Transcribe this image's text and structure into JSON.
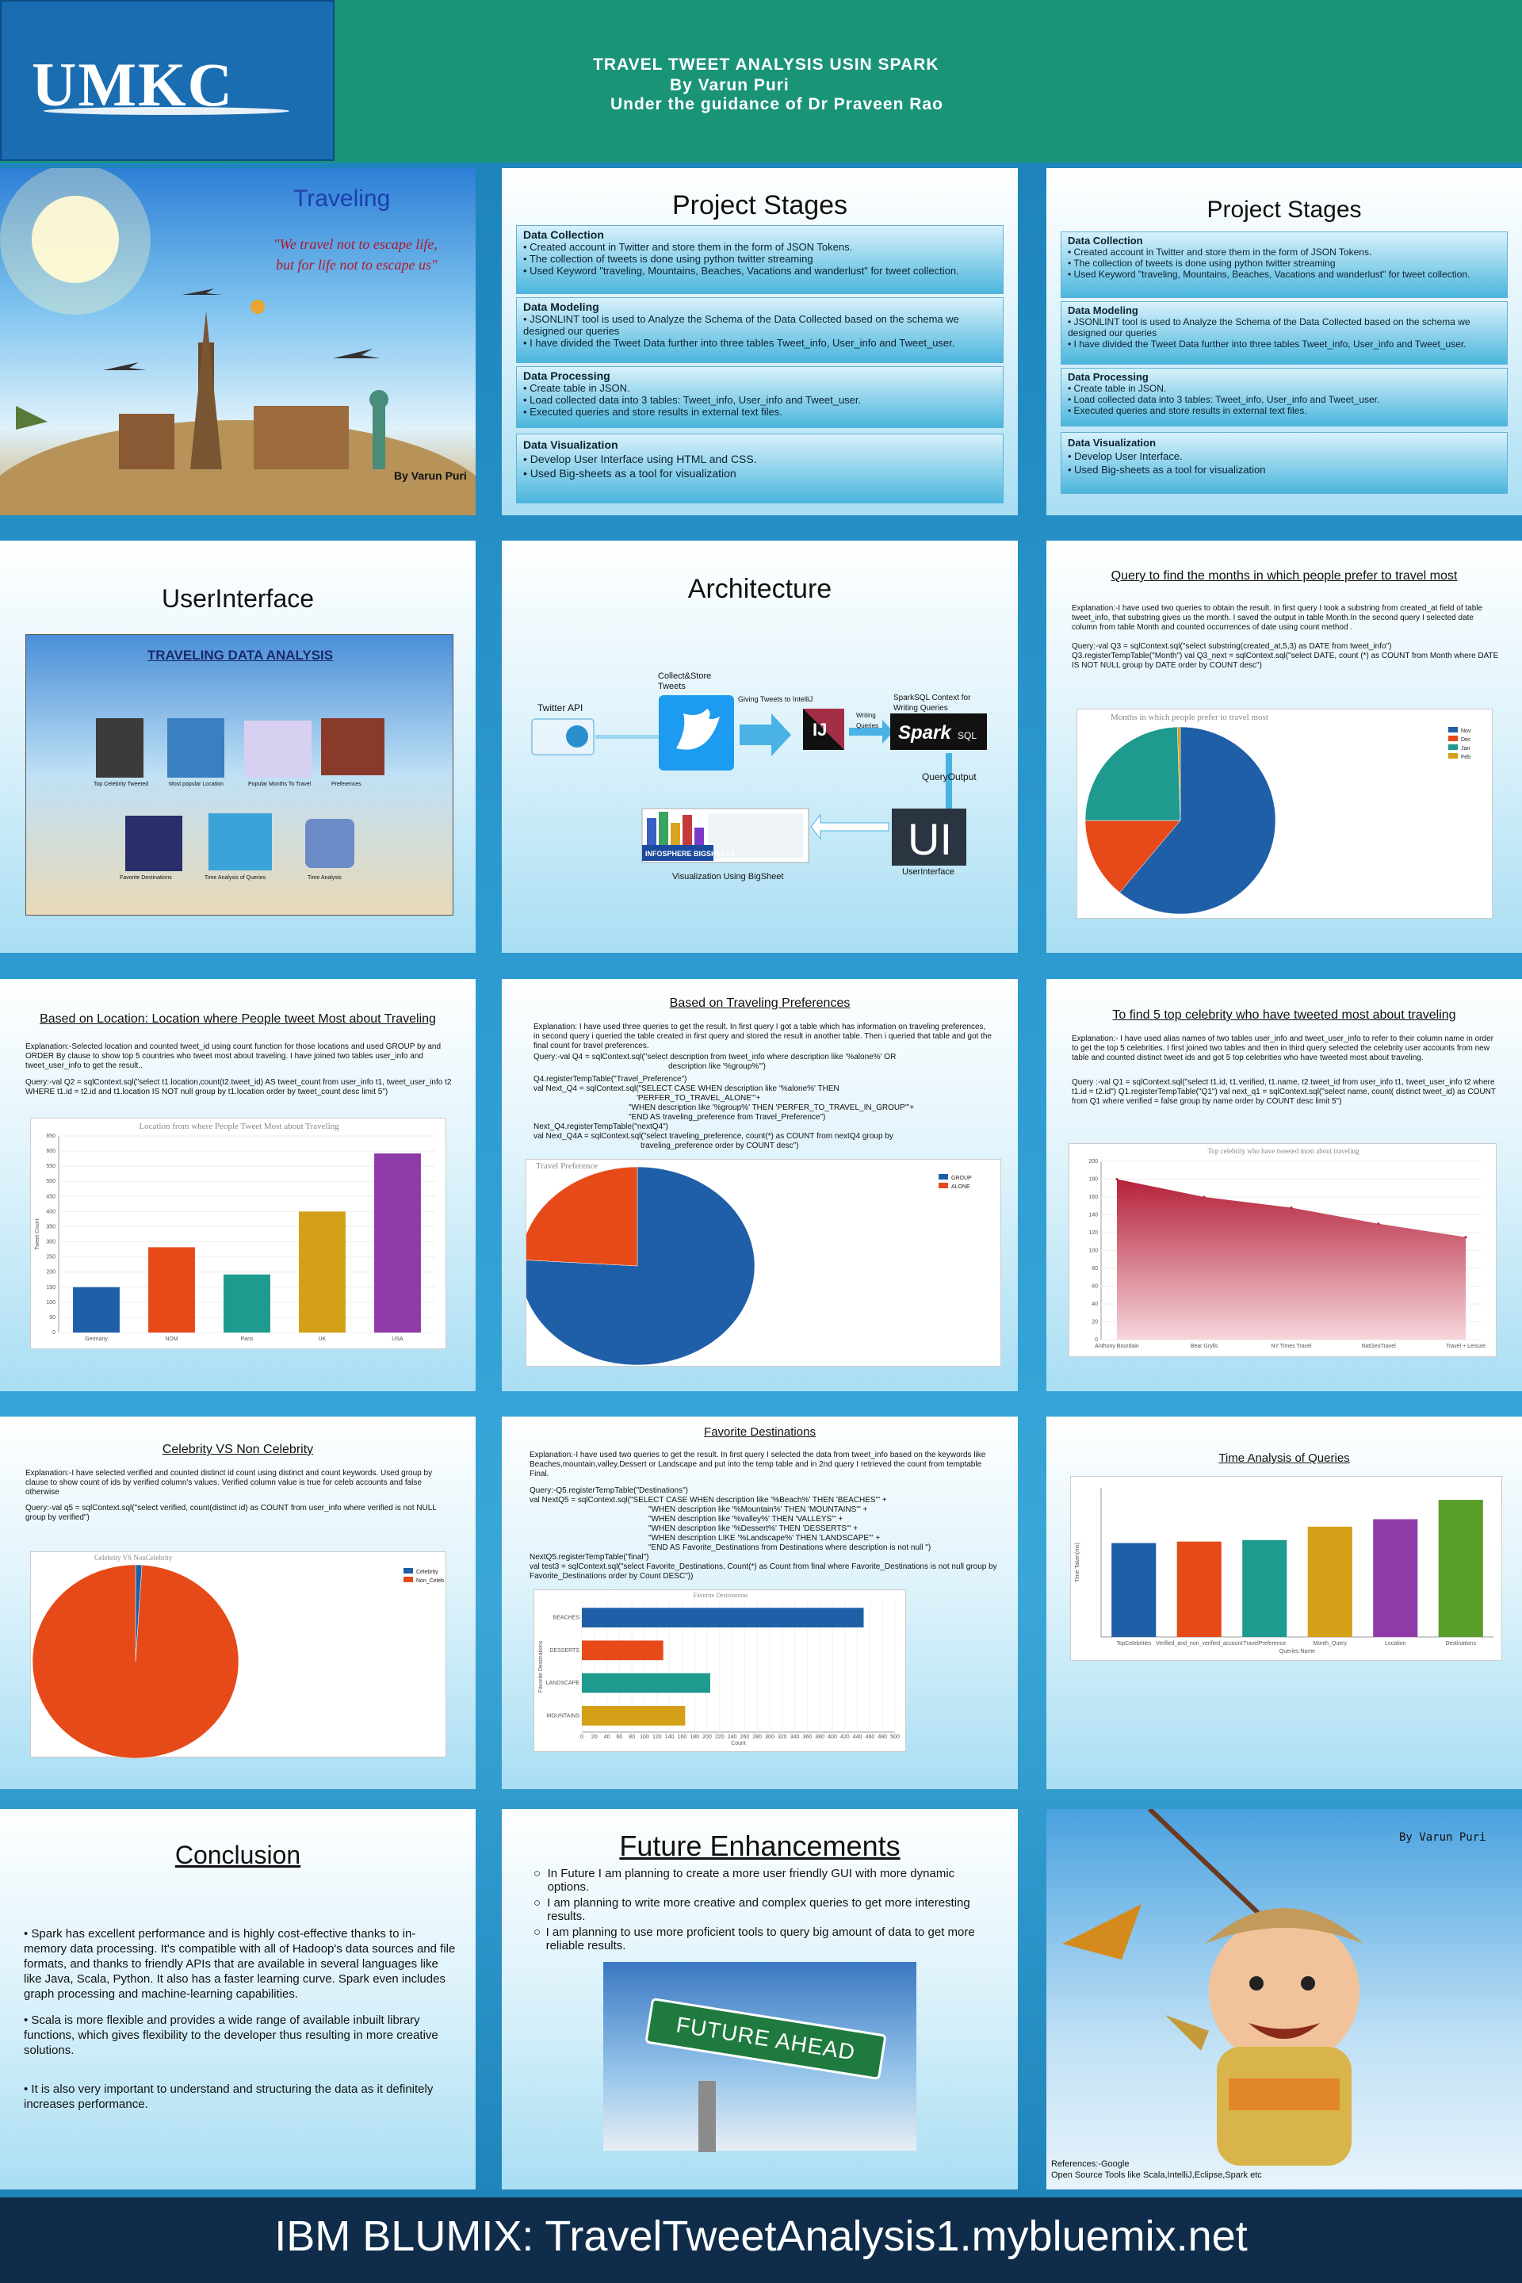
{
  "header": {
    "logo": "UMKC",
    "title_line1": "TRAVEL TWEET ANALYSIS USIN SPARK",
    "title_line2": "By Varun Puri",
    "title_line3": "Under the guidance of Dr Praveen Rao"
  },
  "traveling_panel": {
    "title": "Traveling",
    "quote_line1": "\"We travel not to escape life,",
    "quote_line2": "but for life not to escape us\"",
    "byline": "By Varun Puri"
  },
  "project_stages": {
    "title": "Project Stages",
    "stages": [
      {
        "heading": "Data Collection",
        "lines": [
          "• Created account in Twitter and store them in the form of JSON Tokens.",
          "• The collection of tweets is done using python twitter streaming",
          "• Used Keyword \"traveling, Mountains, Beaches, Vacations and wanderlust\" for tweet collection."
        ]
      },
      {
        "heading": "Data Modeling",
        "lines": [
          "• JSONLINT tool is used to Analyze the Schema of the Data Collected based on the schema we designed our queries",
          "• I have divided the Tweet Data further into three tables Tweet_info, User_info and Tweet_user."
        ]
      },
      {
        "heading": "Data Processing",
        "lines": [
          "• Create table in JSON.",
          "• Load collected data into 3 tables: Tweet_info, User_info and Tweet_user.",
          "• Executed queries and store results in external text files."
        ]
      },
      {
        "heading": "Data Visualization",
        "lines": [
          "• Develop User Interface using HTML and CSS.",
          "• Used Big-sheets as a tool for visualization"
        ]
      }
    ],
    "viz_line1_alt": "• Develop User Interface."
  },
  "user_interface": {
    "title": "UserInterface",
    "banner": "TRAVELING DATA ANALYSIS",
    "labels": [
      "Top Celebrity Tweeted",
      "Most popular Location",
      "Popular Months To Travel",
      "Preferences",
      "Favorite Destinations",
      "Time Analysis of Queries",
      "Time Analysis"
    ]
  },
  "architecture": {
    "title": "Architecture",
    "twitter_api": "Twitter API",
    "collect": "Collect&Store Tweets",
    "giving": "Giving Tweets to IntelliJ",
    "writing": "Writing Queries",
    "spark_context": "SparkSQL Context for Writing Queries",
    "query_output": "QueryOutput",
    "visualization": "Visualization Using BigSheet",
    "ui_label": "UserInterface",
    "ui_box": "UI",
    "bigsheets": "INFOSPHERE BIGSHEETS"
  },
  "months_panel": {
    "title": "Query to find the months in which people prefer to travel most",
    "explanation": "Explanation:-I have used two queries to obtain the result. In first query I took a substring from created_at field of table tweet_info, that substring gives us the month. I saved the output in table Month.In the second query I selected date column from table Month and counted occurrences of date using count method .",
    "query": "Query:-val Q3 = sqlContext.sql(\"select substring(created_at,5,3) as DATE from tweet_info\") Q3.registerTempTable(\"Month\") val Q3_next = sqlContext.sql(\"select DATE, count (*) as COUNT from Month where DATE IS NOT NULL group by DATE order by COUNT desc\")",
    "chart_title": "Months in which people prefer to travel most"
  },
  "location_panel": {
    "title": "Based on Location: Location where People tweet Most about Traveling",
    "explanation": "Explanation:-Selected location and counted tweet_id using count function for those locations and used GROUP by and ORDER By clause to show top 5 countries who tweet most about traveling. I have joined two tables user_info and tweet_user_info to get the result..",
    "query": "Query:-val Q2 = sqlContext.sql(\"select t1.location,count(t2.tweet_id) AS tweet_count from user_info t1, tweet_user_info t2 WHERE t1.id = t2.id and t1.location IS NOT null group by t1.location order by tweet_count desc limit 5\")",
    "chart_title": "Location from where People Tweet Most about Traveling",
    "ylabel": "Tweet Count"
  },
  "preferences_panel": {
    "title": "Based on Traveling Preferences",
    "explanation": "Explanation: I have used three queries to get the result. In first query I got a table which has information on traveling preferences, in second query i queried the table created in first query and stored the result in another table. Then i queried that table and got the final count for travel preferences.",
    "query": [
      "Query:-val Q4 = sqlContext.sql(\"select description from tweet_info where description like '%alone%' OR",
      "description like '%group%'\")",
      "Q4.registerTempTable(\"Travel_Preference\")",
      "val Next_Q4 = sqlContext.sql(\"SELECT CASE WHEN description like '%alone%' THEN",
      "'PERFER_TO_TRAVEL_ALONE'\"+",
      "\"WHEN description like '%group%' THEN 'PERFER_TO_TRAVEL_IN_GROUP'\"+",
      "\"END AS traveling_preference from Travel_Preference\")",
      "Next_Q4.registerTempTable(\"nextQ4\")",
      "val Next_Q4A = sqlContext.sql(\"select traveling_preference, count(*) as COUNT from nextQ4 group by",
      "traveling_preference order by COUNT desc\")"
    ],
    "chart_title": "Travel Preference"
  },
  "celebrity_panel": {
    "title": "To find 5 top celebrity who have tweeted most about traveling",
    "explanation": "Explanation:- I have used alias names of two tables user_info and tweet_user_info to refer to their column name in order to get the top 5 celebrities. I first joined two tables and then in third query selected the celebrity user accounts from new table and counted distinct tweet ids and got 5 top celebrities who have tweeted most about traveling.",
    "query": "Query :-val Q1 = sqlContext.sql(\"select t1.id, t1.verified, t1.name, t2.tweet_id from user_info t1, tweet_user_info t2 where t1.id = t2.id\") Q1.registerTempTable(\"Q1\") val next_q1 = sqlContext.sql(\"select name, count( distinct tweet_id) as COUNT from Q1 where verified = false group by name order by COUNT desc limit 5\")",
    "chart_title": "Top celebrity who have tweeted most about traveling"
  },
  "celeb_vs_panel": {
    "title": "Celebrity VS Non Celebrity",
    "explanation": "Explanation:-I have selected verified and counted distinct id count using distinct and count keywords. Used group by clause to show count of ids by verified column's values. Verified column value is true for celeb accounts and false otherwise",
    "query": "Query:-val q5 = sqlContext.sql(\"select verified, count(distinct id) as COUNT from user_info where verified is not NULL group by verified\")",
    "chart_title": "Celebrity VS NonCelebrity"
  },
  "destinations_panel": {
    "title": "Favorite Destinations",
    "explanation": "Explanation:-I have used two queries to get the result. In first query I selected the data from tweet_info based on the keywords like Beaches,mountain,valley,Dessert or Landscape and put into the temp table and in 2nd query I retrieved the count from temptable Final.",
    "query": [
      "Query:-Q5.registerTempTable(\"Destinations\")",
      "val NextQ5 = sqlContext.sql(\"SELECT CASE WHEN description like '%Beach%' THEN 'BEACHES'\" +",
      "\"WHEN description like '%Mountain%' THEN 'MOUNTAINS'\" +",
      "\"WHEN description like '%valley%' THEN 'VALLEYS'\" +",
      "\"WHEN description like '%Dessert%' THEN 'DESSERTS'\" +",
      "\"WHEN description LIKE '%Landscape%' THEN 'LANDSCAPE'\" +",
      "\"END AS Favorite_Destinations from Destinations where description is not null \")",
      "NextQ5.registerTempTable(\"final\")",
      "val test3 = sqlContext.sql(\"select Favorite_Destinations, Count(*) as Count from final where Favorite_Destinations is not null group by Favorite_Destinations order by Count DESC\"))"
    ],
    "chart_title": "Favorite Destinations"
  },
  "time_panel": {
    "title": "Time Analysis of Queries",
    "xlabel": "Queries Name",
    "ylabel": "Time Taken(ms)"
  },
  "conclusion": {
    "title": "Conclusion",
    "bullets": [
      "• Spark has excellent performance and is highly cost-effective thanks to in-memory data processing. It's compatible with all of Hadoop's data sources and file formats, and thanks to friendly APIs that are available in several languages like like Java, Scala, Python. It also has a faster learning curve. Spark even includes graph processing and machine-learning capabilities.",
      "• Scala is more flexible and provides a wide range of available inbuilt library functions, which gives flexibility to the developer thus resulting in more creative solutions.",
      "• It is also very important to understand and structuring the data as it definitely increases performance."
    ]
  },
  "future": {
    "title": "Future Enhancements",
    "bullets": [
      "In Future I am planning to create a more user friendly GUI with more dynamic options.",
      "I am planning to write more creative and complex queries to get more interesting results.",
      "I am planning to use more proficient tools to query big amount of data to get more reliable results."
    ],
    "sign": "FUTURE AHEAD"
  },
  "final_panel": {
    "byline": "By Varun Puri",
    "ref1": "References:-Google",
    "ref2": "Open Source Tools like Scala,IntelliJ,Eclipse,Spark etc"
  },
  "footer": {
    "text": "IBM BLUMIX: TravelTweetAnalysis1.mybluemix.net"
  },
  "colors": {
    "header_green": "#1a9477",
    "umkc_blue": "#1a6db1",
    "footer_navy": "#0f2d4a",
    "blue": "#1f5fa8",
    "orange": "#e64a19",
    "teal": "#1e9a8e",
    "gold": "#d4a017",
    "purple": "#8e3aa8",
    "crimson": "#b5213a"
  },
  "chart_data": [
    {
      "id": "months",
      "type": "pie",
      "title": "Months in which people prefer to travel most",
      "legend": "right",
      "slices": [
        {
          "label": "Nov",
          "value": 61
        },
        {
          "label": "Dec",
          "value": 14
        },
        {
          "label": "Jan",
          "value": 24.5
        },
        {
          "label": "Feb",
          "value": 0.5
        }
      ]
    },
    {
      "id": "location",
      "type": "bar",
      "title": "Location from where People Tweet Most about Traveling",
      "ylabel": "Tweet Count",
      "categories": [
        "Germany",
        "NOM",
        "Paris",
        "UK",
        "USA"
      ],
      "values": [
        150,
        282,
        192,
        400,
        592
      ],
      "ylim": [
        0,
        650
      ],
      "yticks": [
        0,
        50,
        100,
        150,
        200,
        250,
        300,
        350,
        400,
        450,
        500,
        550,
        600,
        650
      ]
    },
    {
      "id": "preference",
      "type": "pie",
      "title": "Travel Preference",
      "legend": "right",
      "slices": [
        {
          "label": "GROUP",
          "value": 76
        },
        {
          "label": "ALONE",
          "value": 24
        }
      ]
    },
    {
      "id": "celebrity",
      "type": "area",
      "title": "Top celebrity who have tweeted most about traveling",
      "categories": [
        "Anthony Bourdain",
        "Bear Grylls",
        "NY Times Travel",
        "NatGeoTravel",
        "Travel + Leisure"
      ],
      "values": [
        180,
        160,
        148,
        130,
        115
      ],
      "ylim": [
        0,
        200
      ],
      "yticks": [
        0,
        20,
        40,
        60,
        80,
        100,
        120,
        140,
        160,
        180,
        200
      ]
    },
    {
      "id": "celeb_vs",
      "type": "pie",
      "title": "Celebrity VS NonCelebrity",
      "legend": "right",
      "slices": [
        {
          "label": "Celebrity",
          "value": 1
        },
        {
          "label": "Non_Celeb",
          "value": 99
        }
      ]
    },
    {
      "id": "destinations",
      "type": "bar",
      "orientation": "horizontal",
      "title": "Favorite Destinations",
      "ylabel": "Favorite Destinations",
      "xlabel": "Count",
      "categories": [
        "BEACHES",
        "DESSERTS",
        "LANDSCAPE",
        "MOUNTAINS"
      ],
      "values": [
        450,
        130,
        205,
        165
      ],
      "xlim": [
        0,
        500
      ],
      "xticks": [
        0,
        20,
        40,
        60,
        80,
        100,
        120,
        140,
        160,
        180,
        200,
        220,
        240,
        260,
        280,
        300,
        320,
        340,
        360,
        380,
        400,
        420,
        440,
        460,
        480,
        500
      ]
    },
    {
      "id": "time",
      "type": "bar",
      "title": "Time Analysis of Queries",
      "xlabel": "Queries Name",
      "ylabel": "Time Taken(ms)",
      "categories": [
        "TopCelebrities",
        "Verified_and_non_verified_account",
        "TravelPreference",
        "Month_Query",
        "Location",
        "Destinations"
      ],
      "values": [
        6300,
        6400,
        6500,
        7400,
        7900,
        9200
      ],
      "ylim": [
        0,
        10000
      ]
    }
  ]
}
